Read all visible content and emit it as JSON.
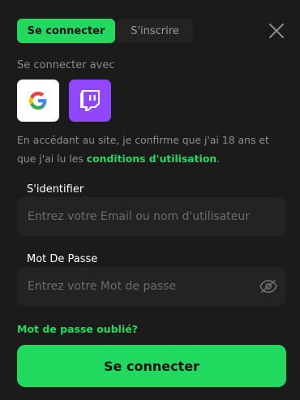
{
  "tabs": [
    {
      "label": "Se connecter",
      "active": true
    },
    {
      "label": "S'inscrire",
      "active": false
    }
  ],
  "close_icon": "close-icon",
  "social": {
    "label": "Se connecter avec",
    "providers": [
      {
        "name": "google-icon"
      },
      {
        "name": "twitch-icon"
      }
    ]
  },
  "terms": {
    "text": "En accédant au site, je confirme que j'ai 18 ans et que j'ai lu les ",
    "link": "conditions d'utilisation",
    "suffix": "."
  },
  "identifier": {
    "label": "S'identifier",
    "placeholder": "Entrez votre Email ou nom d'utilisateur",
    "value": ""
  },
  "password": {
    "label": "Mot De Passe",
    "placeholder": "Entrez votre Mot de passe",
    "value": "",
    "toggle_icon": "eye-off-icon"
  },
  "forgot_link": "Mot de passe oublié?",
  "submit_label": "Se connecter",
  "colors": {
    "accent": "#22d960",
    "background": "#1b1b1b",
    "input_bg": "#232323",
    "twitch": "#9146ff"
  }
}
